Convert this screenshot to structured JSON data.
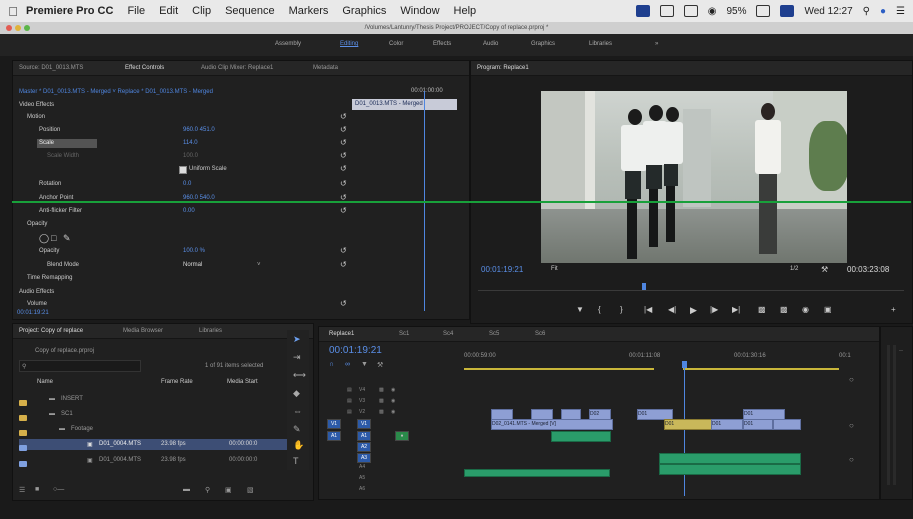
{
  "menubar": {
    "app": "Premiere Pro CC",
    "items": [
      "File",
      "Edit",
      "Clip",
      "Sequence",
      "Markers",
      "Graphics",
      "Window",
      "Help"
    ],
    "battery": "95%",
    "clock": "Wed 12:27"
  },
  "window_title": "/Volumes/Lantunry/Thesis Project/PROJECT/Copy of replace.prproj *",
  "workspaces": [
    "Assembly",
    "Editing",
    "Color",
    "Effects",
    "Audio",
    "Graphics",
    "Libraries"
  ],
  "workspace_more": "»",
  "effect_controls": {
    "tabs": [
      "Source: D01_0013.MTS",
      "Effect Controls",
      "Audio Clip Mixer: Replace1",
      "Metadata"
    ],
    "master": "Master * D01_0013.MTS - Merged  ˅  Replace * D01_0013.MTS - Merged",
    "timecode_top": "00:01:00:00",
    "clip_label": "D01_0013.MTS - Merged",
    "sections": {
      "video_effects": "Video Effects",
      "motion": "Motion",
      "opacity": "Opacity",
      "time_remap": "Time Remapping",
      "audio_effects": "Audio Effects",
      "volume": "Volume"
    },
    "rows": [
      {
        "label": "Position",
        "value": "960.0     451.0"
      },
      {
        "label": "Scale",
        "value": "114.0"
      },
      {
        "label": "Scale Width",
        "value": "100.0"
      },
      {
        "label": "Uniform Scale",
        "value": ""
      },
      {
        "label": "Rotation",
        "value": "0.0"
      },
      {
        "label": "Anchor Point",
        "value": "960.0     540.0"
      },
      {
        "label": "Anti-flicker Filter",
        "value": "0.00"
      }
    ],
    "opacity_value": "100.0 %",
    "blend_mode_label": "Blend Mode",
    "blend_mode_value": "Normal",
    "bottom_timecode": "00:01:19:21"
  },
  "program": {
    "title": "Program: Replace1",
    "timecode": "00:01:19:21",
    "fit": "Fit",
    "fraction": "1/2",
    "duration": "00:03:23:08"
  },
  "project": {
    "tabs": [
      "Project: Copy of replace",
      "Media Browser",
      "Libraries"
    ],
    "name": "Copy of replace.prproj",
    "selection": "1 of 91 items selected",
    "columns": [
      "Name",
      "Frame Rate",
      "Media Start"
    ],
    "items": [
      {
        "name": "INSERT",
        "rate": "",
        "start": ""
      },
      {
        "name": "SC1",
        "rate": "",
        "start": ""
      },
      {
        "name": "Footage",
        "rate": "",
        "start": ""
      },
      {
        "name": "D01_0004.MTS",
        "rate": "23.98 fps",
        "start": "00:00:00:0"
      },
      {
        "name": "D01_0004.MTS",
        "rate": "23.98 fps",
        "start": "00:00:00:0"
      }
    ]
  },
  "timeline": {
    "tabs": [
      "Replace1",
      "Sc1",
      "Sc4",
      "Sc5",
      "Sc6"
    ],
    "timecode": "00:01:19:21",
    "ruler": [
      "00:00:59:00",
      "00:01:11:08",
      "00:01:30:16",
      "00:1"
    ],
    "tracks": [
      "V4",
      "V3",
      "V2",
      "V1",
      "A1",
      "A2",
      "A3",
      "A4",
      "A5",
      "A6"
    ],
    "clips": [
      "D02",
      "D02_0141.MTS - Merged [V]",
      "D01",
      "D01",
      "D01",
      "D01",
      "D01"
    ]
  },
  "colors": {
    "accent": "#4f86e0",
    "clip_video": "#8e9fd4",
    "clip_audio": "#2a9c6a",
    "guide": "#18a03a"
  }
}
